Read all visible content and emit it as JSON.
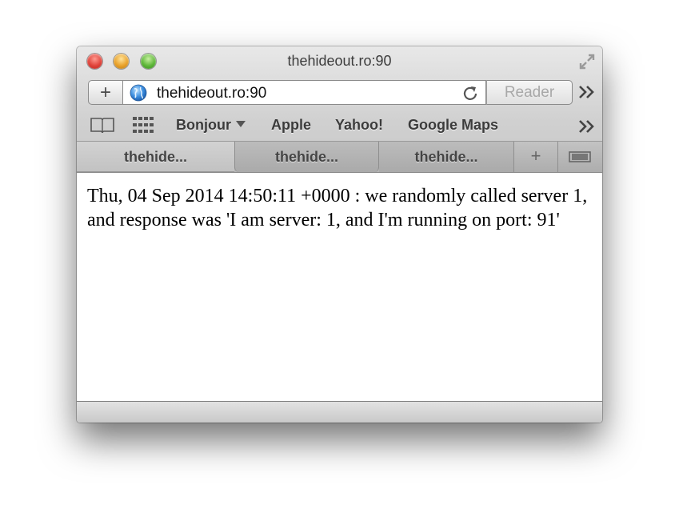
{
  "window": {
    "title": "thehideout.ro:90"
  },
  "toolbar": {
    "new_tab_symbol": "+",
    "url": "thehideout.ro:90",
    "reader_label": "Reader"
  },
  "bookmarks": {
    "items": [
      "Bonjour",
      "Apple",
      "Yahoo!",
      "Google Maps"
    ]
  },
  "tabs": [
    {
      "label": "thehide..."
    },
    {
      "label": "thehide..."
    },
    {
      "label": "thehide..."
    }
  ],
  "tab_add_symbol": "+",
  "page": {
    "text": "Thu, 04 Sep 2014 14:50:11 +0000 : we randomly called server 1, and response was 'I am server: 1, and I'm running on port: 91'"
  },
  "icons": {
    "globe": "globe-icon",
    "reload": "reload-icon",
    "overflow": "double-chevron-icon",
    "reading_list": "book-icon",
    "top_sites": "grid-icon",
    "fullscreen": "fullscreen-icon",
    "tab_overview": "tab-overview-icon"
  }
}
